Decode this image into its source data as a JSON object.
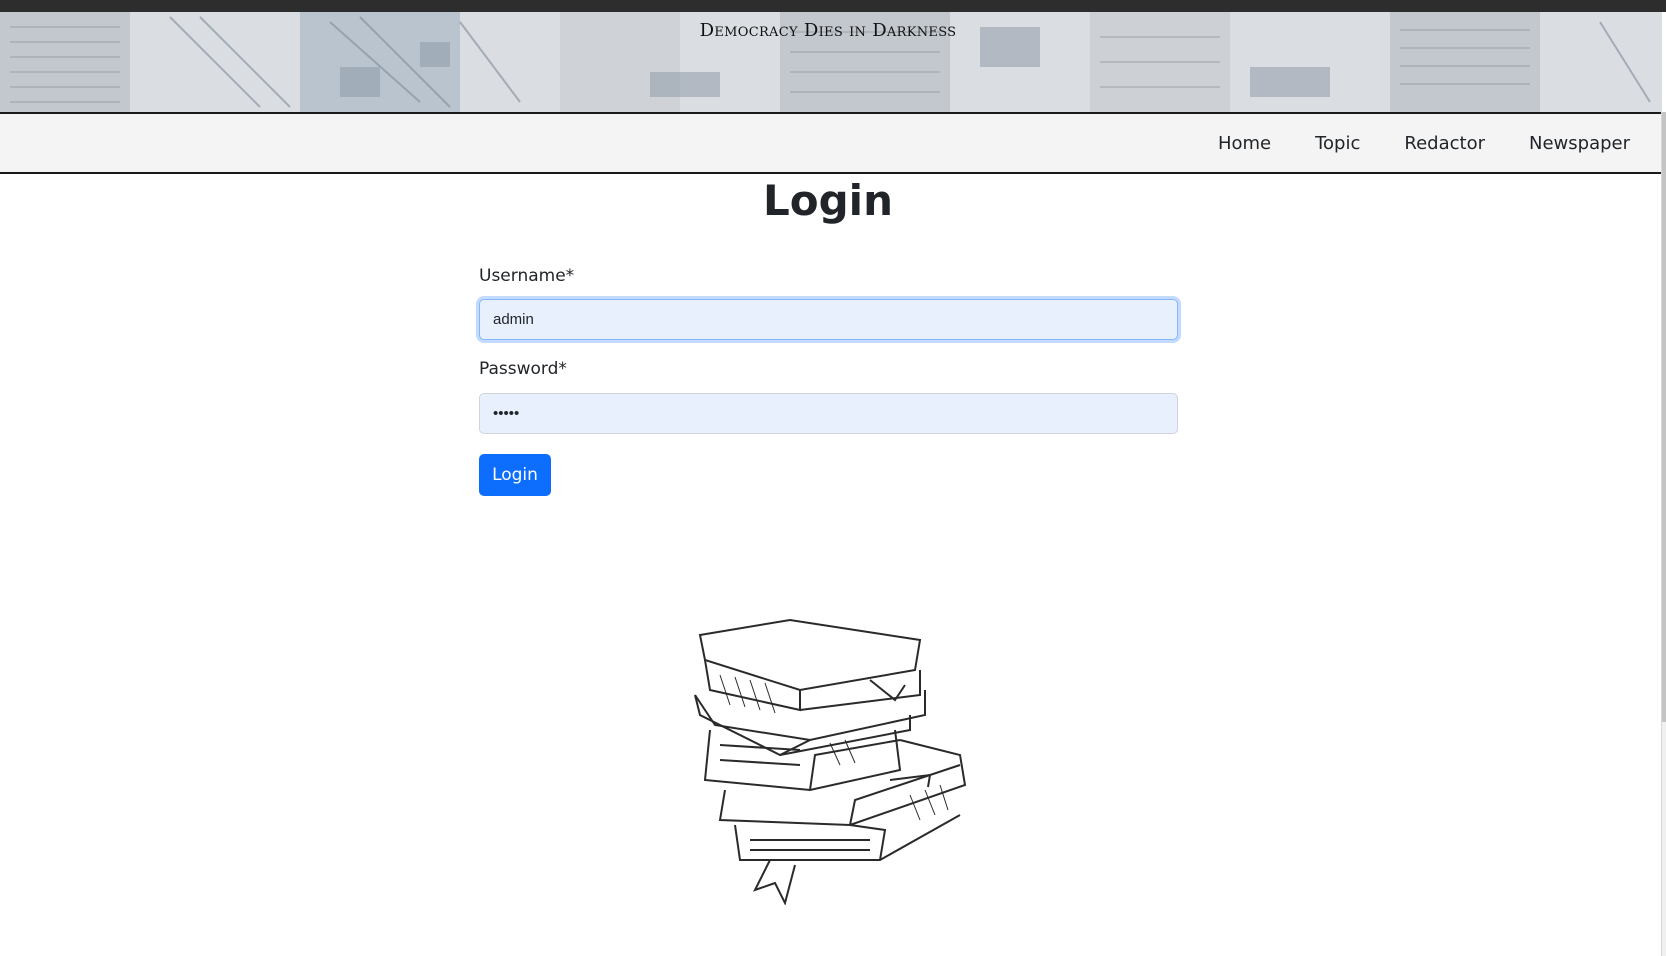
{
  "banner": {
    "tagline": "Democracy Dies in Darkness"
  },
  "nav": {
    "items": [
      {
        "label": "Home"
      },
      {
        "label": "Topic"
      },
      {
        "label": "Redactor"
      },
      {
        "label": "Newspaper"
      }
    ]
  },
  "login": {
    "title": "Login",
    "username_label": "Username*",
    "username_value": "admin",
    "password_label": "Password*",
    "password_value": "•••••",
    "submit_label": "Login"
  },
  "colors": {
    "primary": "#0d6efd",
    "input_bg": "#e8f0fe",
    "navbar_bg": "#f4f4f4"
  },
  "icons": {
    "illustration": "stack-of-books-illustration"
  }
}
